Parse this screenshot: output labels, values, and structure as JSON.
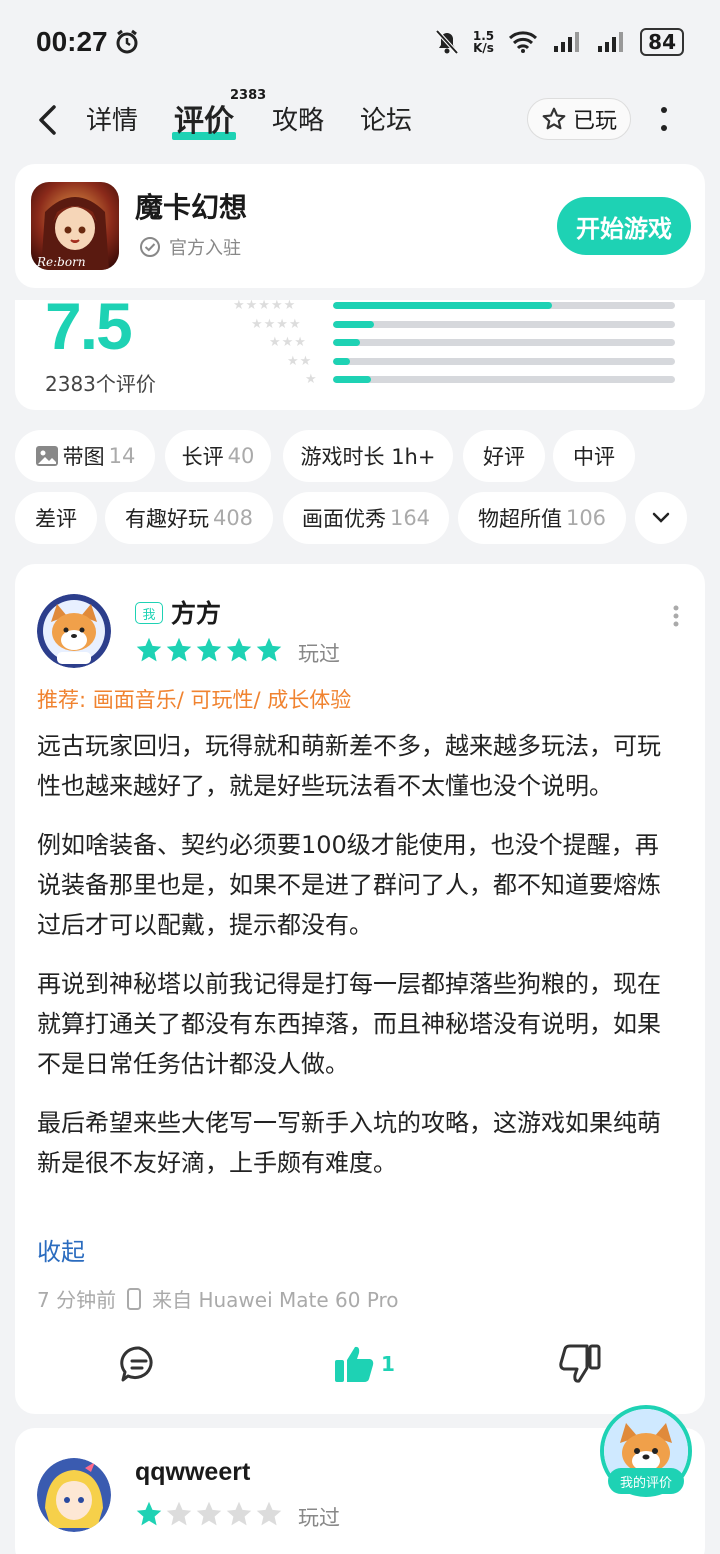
{
  "status_bar": {
    "time": "00:27",
    "net_speed_value": "1.5",
    "net_speed_unit": "K/s",
    "battery": "84"
  },
  "nav": {
    "tabs": [
      {
        "label": "详情"
      },
      {
        "label": "评价"
      },
      {
        "label": "攻略"
      },
      {
        "label": "论坛"
      }
    ],
    "review_count_badge": "2383",
    "played_label": "已玩"
  },
  "game": {
    "name": "魔卡幻想",
    "icon_text": "Re:born",
    "official_label": "官方入驻",
    "start_button": "开始游戏"
  },
  "rating": {
    "score": "7.5",
    "count_label": "2383个评价",
    "distribution": [
      {
        "stars": 5,
        "fraction": 0.64
      },
      {
        "stars": 4,
        "fraction": 0.12
      },
      {
        "stars": 3,
        "fraction": 0.08
      },
      {
        "stars": 2,
        "fraction": 0.05
      },
      {
        "stars": 1,
        "fraction": 0.11
      }
    ]
  },
  "filters": {
    "row1": [
      {
        "label": "带图",
        "count": "14",
        "icon": "image-icon"
      },
      {
        "label": "长评",
        "count": "40"
      },
      {
        "label": "游戏时长 1h+",
        "count": ""
      },
      {
        "label": "好评",
        "count": ""
      },
      {
        "label": "中评",
        "count": ""
      }
    ],
    "row2": [
      {
        "label": "差评",
        "count": ""
      },
      {
        "label": "有趣好玩",
        "count": "408"
      },
      {
        "label": "画面优秀",
        "count": "164"
      },
      {
        "label": "物超所值",
        "count": "106"
      }
    ]
  },
  "review1": {
    "me_tag": "我",
    "username": "方方",
    "stars": 5,
    "played": "玩过",
    "recommend": "推荐: 画面音乐/ 可玩性/ 成长体验",
    "paragraphs": [
      "远古玩家回归，玩得就和萌新差不多，越来越多玩法，可玩性也越来越好了，就是好些玩法看不太懂也没个说明。",
      "例如啥装备、契约必须要100级才能使用，也没个提醒，再说装备那里也是，如果不是进了群问了人，都不知道要熔炼过后才可以配戴，提示都没有。",
      "再说到神秘塔以前我记得是打每一层都掉落些狗粮的，现在就算打通关了都没有东西掉落，而且神秘塔没有说明，如果不是日常任务估计都没人做。",
      "最后希望来些大佬写一写新手入坑的攻略，这游戏如果纯萌新是很不友好滴，上手颇有难度。"
    ],
    "collapse": "收起",
    "time": "7 分钟前",
    "device": "来自 Huawei Mate 60 Pro",
    "likes": "1"
  },
  "review2": {
    "username": "qqwweert",
    "stars": 1,
    "played": "玩过"
  },
  "floating": {
    "my_review_label": "我的评价"
  },
  "colors": {
    "accent": "#1ed2b4",
    "recommend": "#f08330",
    "link": "#2b6cbf"
  }
}
